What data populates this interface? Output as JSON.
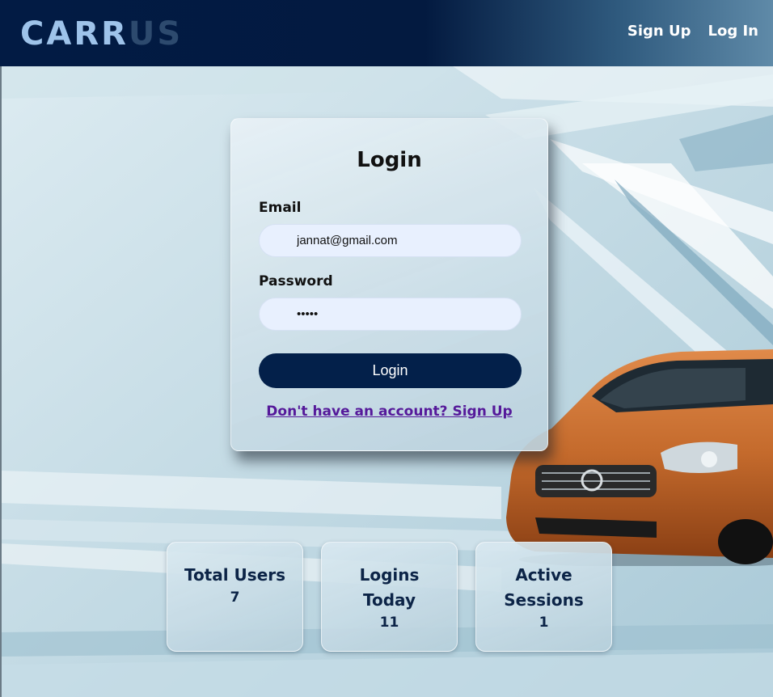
{
  "header": {
    "logo_part1": "CARR",
    "logo_part2": "US",
    "nav": {
      "signup": "Sign Up",
      "login": "Log In"
    }
  },
  "login_form": {
    "title": "Login",
    "email_label": "Email",
    "email_value": "jannat@gmail.com",
    "password_label": "Password",
    "password_masked": "•••••",
    "submit_label": "Login",
    "signup_prompt": "Don't have an account? Sign Up"
  },
  "stats": [
    {
      "label": "Total Users",
      "value": "7"
    },
    {
      "label": "Logins Today",
      "value": "11"
    },
    {
      "label": "Active Sessions",
      "value": "1"
    }
  ],
  "colors": {
    "nav_bg": "#021b44",
    "logo_light": "#9ec3ea",
    "logo_dark": "#2d4a6e",
    "button_bg": "#03204a",
    "link": "#55199a",
    "stat_text": "#0c2447",
    "input_bg": "#e8f0fe"
  },
  "background_image": "orange-volvo-car-on-light-blue-abstract-backdrop"
}
